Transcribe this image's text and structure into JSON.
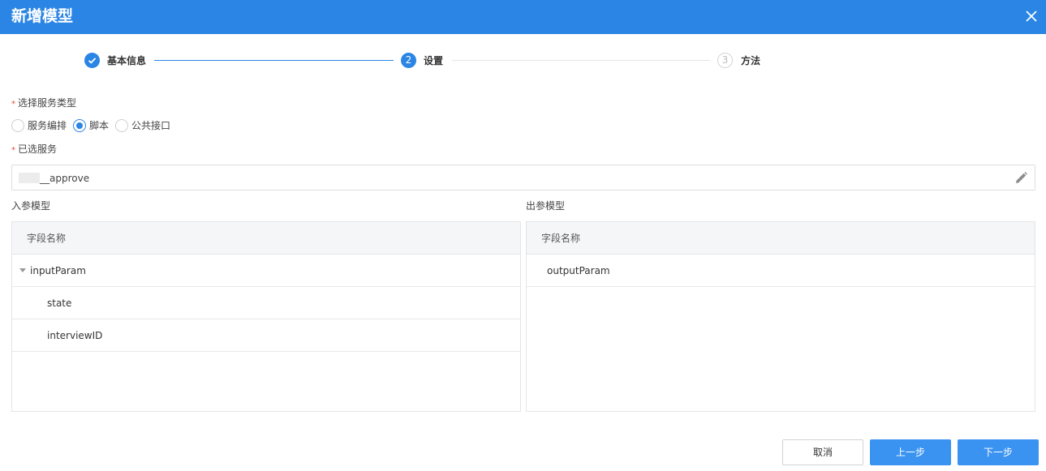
{
  "dialog": {
    "title": "新增模型"
  },
  "steps": [
    {
      "label": "基本信息",
      "number": "1",
      "status": "done"
    },
    {
      "label": "设置",
      "number": "2",
      "status": "active"
    },
    {
      "label": "方法",
      "number": "3",
      "status": "wait"
    }
  ],
  "form": {
    "service_type_label": "选择服务类型",
    "service_type_options": [
      "服务编排",
      "脚本",
      "公共接口"
    ],
    "service_type_selected": "脚本",
    "selected_service_label": "已选服务",
    "selected_service_value": "__approve"
  },
  "input_model": {
    "title": "入参模型",
    "column_header": "字段名称",
    "rows": [
      "inputParam",
      "state",
      "interviewID"
    ]
  },
  "output_model": {
    "title": "出参模型",
    "column_header": "字段名称",
    "rows": [
      "outputParam"
    ]
  },
  "buttons": {
    "cancel": "取消",
    "prev": "上一步",
    "next": "下一步"
  },
  "colors": {
    "accent": "#2b85e4",
    "primary_button": "#3a93f0",
    "required_mark": "#e64b3b"
  },
  "icons": {
    "close": "close-icon",
    "edit": "pencil-icon",
    "check": "check-icon",
    "expand": "caret-down-icon"
  }
}
